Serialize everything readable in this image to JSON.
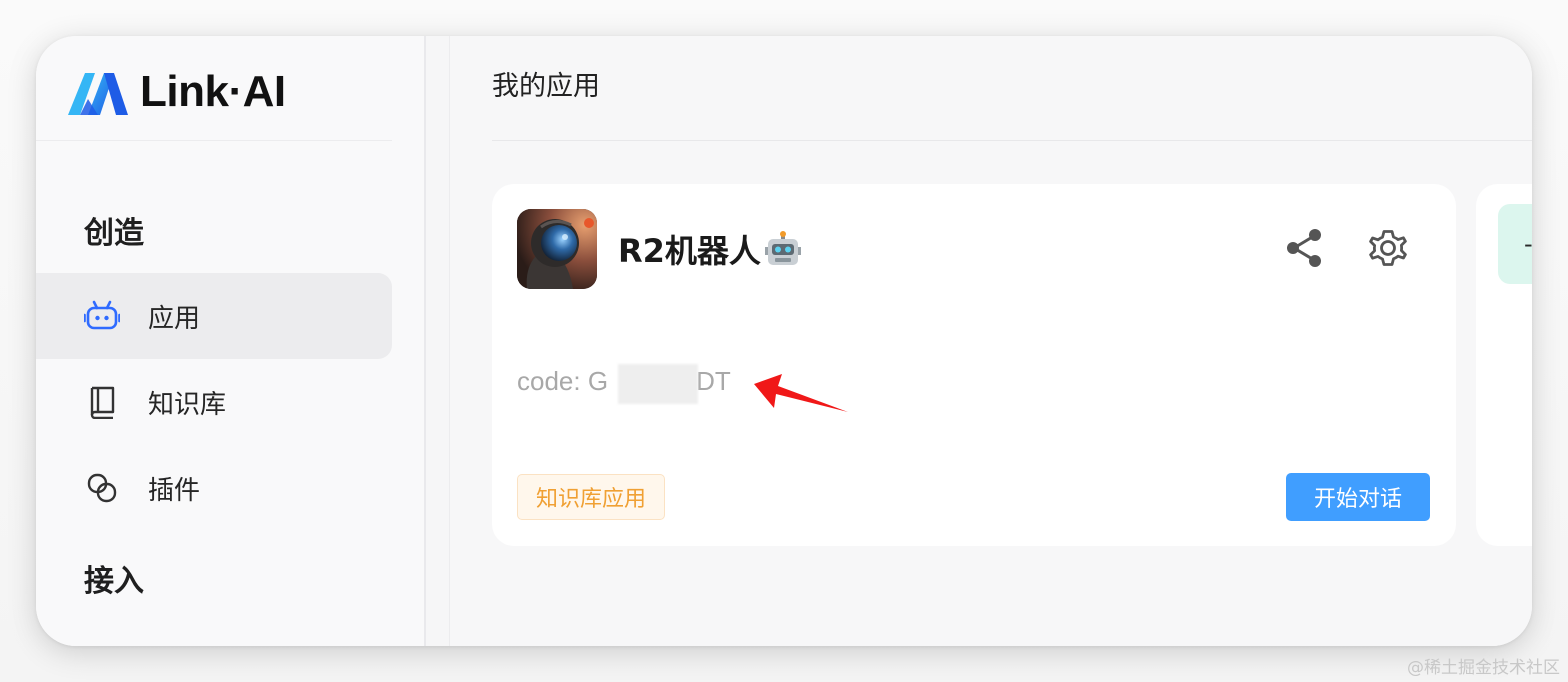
{
  "brand": {
    "name": "Link·AI",
    "accent_dark": "#1e5ce6",
    "accent_light": "#35b6f5"
  },
  "sidebar": {
    "sections": [
      {
        "title": "创造"
      },
      {
        "title": "接入"
      }
    ],
    "items": [
      {
        "label": "应用",
        "icon": "robot-icon",
        "active": true
      },
      {
        "label": "知识库",
        "icon": "book-icon",
        "active": false
      },
      {
        "label": "插件",
        "icon": "plugin-link-icon",
        "active": false
      }
    ]
  },
  "main": {
    "title": "我的应用",
    "card": {
      "name": "R2机器人",
      "name_emoji": "robot-face-emoji",
      "code": "code: G",
      "code_tail": "DT",
      "tag": "知识库应用",
      "start_label": "开始对话",
      "share_icon": "share-icon",
      "settings_icon": "gear-icon"
    },
    "next_card_peek": {
      "badge_text": "-"
    }
  },
  "annotation": {
    "arrow_color": "#f01818"
  },
  "watermark": "@稀土掘金技术社区",
  "colors": {
    "tag_text": "#f0a033",
    "tag_bg": "#fff7ec",
    "primary_button": "#409eff",
    "active_item_bg": "#ececee"
  }
}
